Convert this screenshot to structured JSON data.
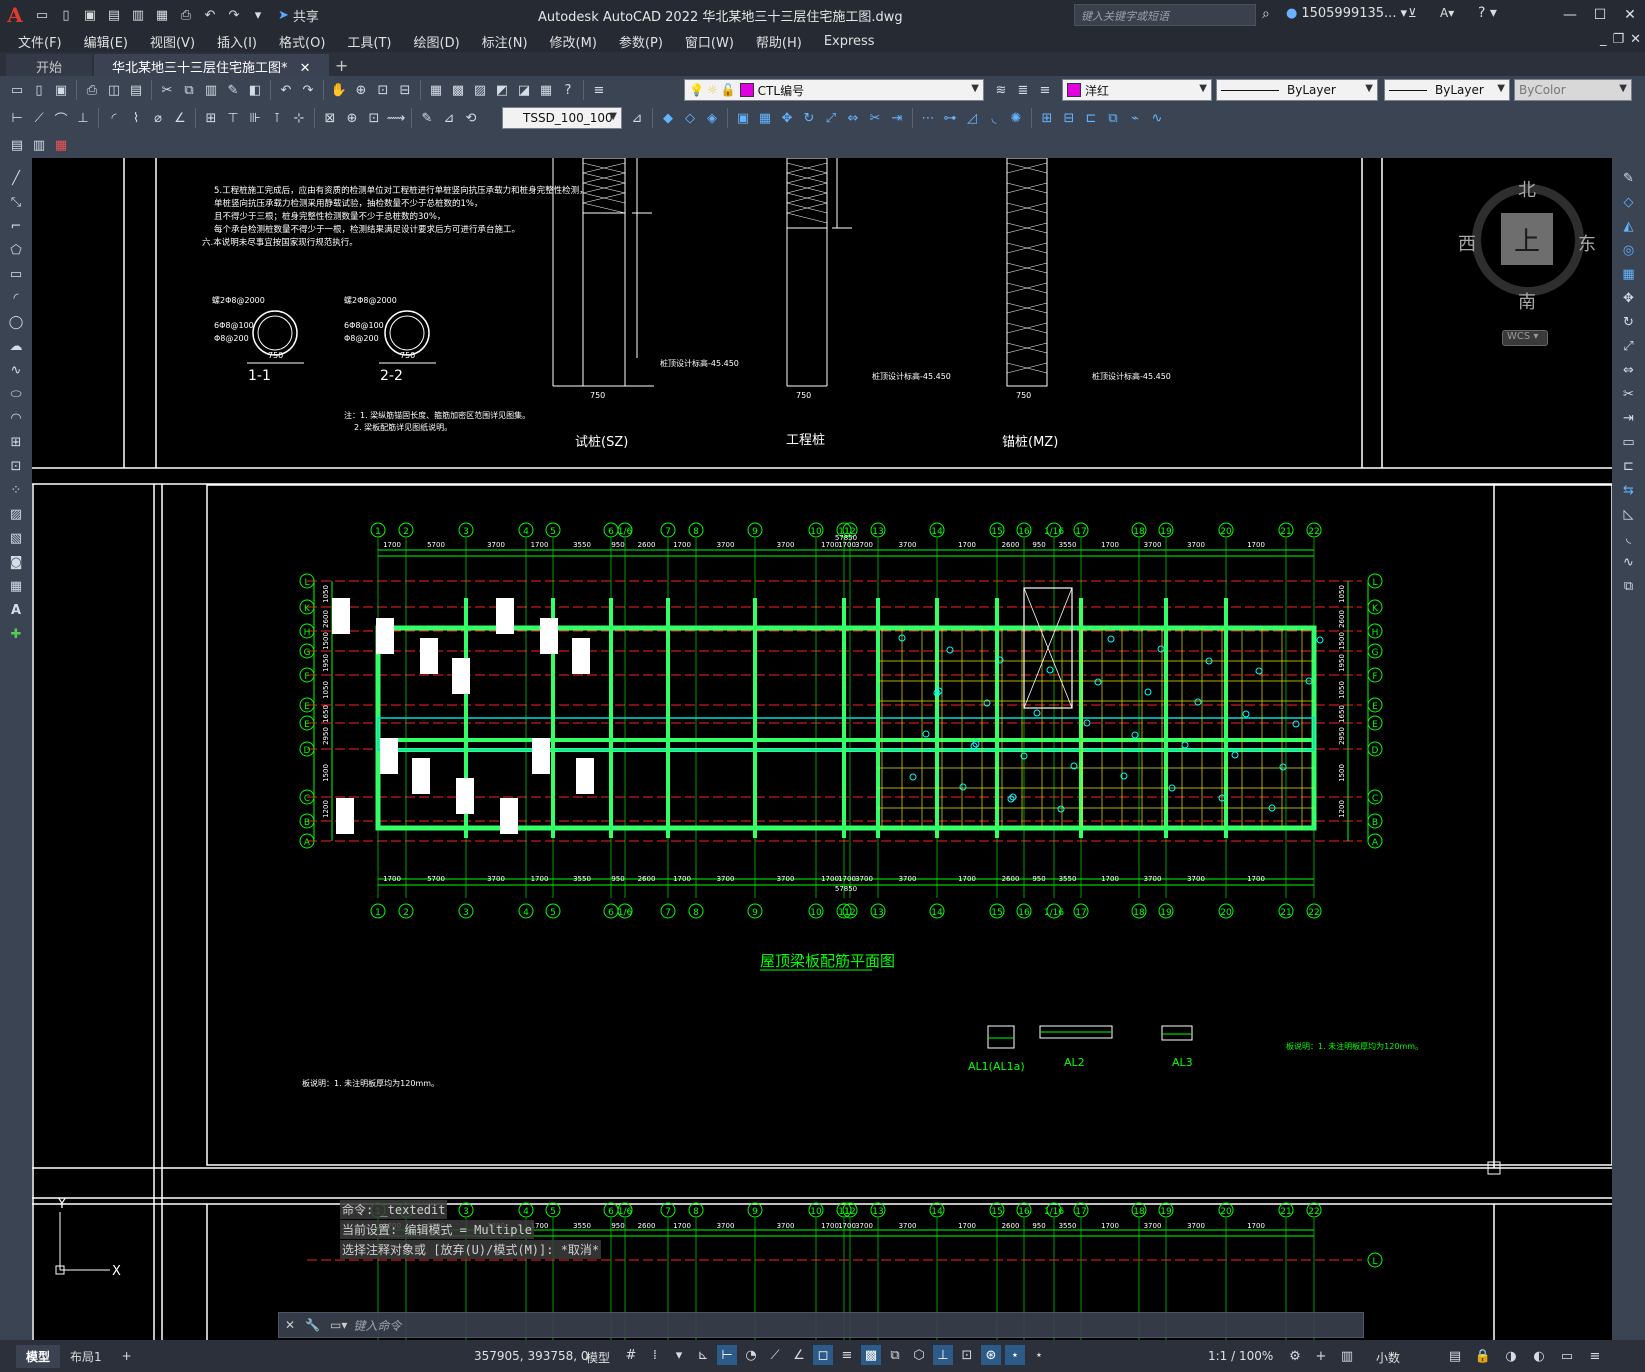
{
  "app": {
    "logo": "A",
    "title": "Autodesk AutoCAD 2022    华北某地三十三层住宅施工图.dwg",
    "search_placeholder": "键入关键字或短语",
    "user": "1505999135...",
    "share_label": "共享"
  },
  "menu": [
    "文件(F)",
    "编辑(E)",
    "视图(V)",
    "插入(I)",
    "格式(O)",
    "工具(T)",
    "绘图(D)",
    "标注(N)",
    "修改(M)",
    "参数(P)",
    "窗口(W)",
    "帮助(H)",
    "Express"
  ],
  "tabs": [
    {
      "label": "开始",
      "active": false
    },
    {
      "label": "华北某地三十三层住宅施工图*",
      "active": true
    }
  ],
  "toolbar": {
    "layer": "CTL编号",
    "color": "洋红",
    "color_hex": "#e000e0",
    "linetype": "ByLayer",
    "lineweight": "ByLayer",
    "plotstyle": "ByColor",
    "dimstyle": "TSSD_100_100"
  },
  "viewcube": {
    "north": "北",
    "south": "南",
    "east": "东",
    "west": "西",
    "face": "上",
    "wcs": "WCS"
  },
  "drawing": {
    "plan_title": "屋顶梁板配筋平面图",
    "top_labels": [
      "试桩(SZ)",
      "工程桩",
      "锚桩(MZ)"
    ],
    "section_labels": [
      "1-1",
      "2-2"
    ],
    "detail_labels": [
      "AL1(AL1a)",
      "AL2",
      "AL3"
    ],
    "dim_750": "750",
    "elev_1": "桩顶设计标高-45.450",
    "elev_2": "桩顶设计标高-45.450",
    "elev_3": "桩顶设计标高-45.450",
    "sec_rebar_1": "6Φ8@100",
    "sec_rebar_2": "Φ8@200",
    "sec_spiral": "螺2Φ8@2000",
    "note_left": "注：1. 梁纵筋锚固长度、箍筋加密区范围详见图集。",
    "note_left2": "2. 梁板配筋详见图纸说明。",
    "note_plan": "板说明：1. 未注明板厚均为120mm。",
    "top_notes": [
      "5.工程桩施工完成后，应由有资质的检测单位对工程桩进行单桩竖向抗压承载力和桩身完整性检测，",
      "单桩竖向抗压承载力检测采用静载试验，抽检数量不少于总桩数的1%，",
      "且不得少于三根；桩身完整性检测数量不少于总桩数的30%，",
      "每个承台检测桩数量不得少于一根，检测结果满足设计要求后方可进行承台施工。",
      "六.本说明未尽事宜按国家现行规范执行。"
    ],
    "axis_numbers": [
      "1",
      "2",
      "3",
      "4",
      "5",
      "6",
      "1/6",
      "7",
      "8",
      "9",
      "10",
      "11",
      "12",
      "13",
      "14",
      "15",
      "16",
      "1/16",
      "17",
      "18",
      "19",
      "20",
      "21",
      "22"
    ],
    "axis_letters": [
      "L",
      "K",
      "H",
      "G",
      "F",
      "E",
      "D",
      "C",
      "B",
      "A"
    ],
    "dims_top": [
      "1700",
      "5700",
      "3700",
      "1700",
      "3550",
      "950",
      "2600",
      "1700",
      "3700",
      "3700",
      "1700",
      "1700",
      "3700",
      "3700",
      "1700",
      "2600",
      "950",
      "3550",
      "1700",
      "3700",
      "3700",
      "1700"
    ],
    "total_dim": "57850",
    "side_dims": [
      "1050",
      "2600",
      "1500",
      "1950",
      "1050",
      "1650",
      "2950",
      "1500",
      "1200"
    ]
  },
  "command": {
    "history": [
      "命令: _textedit",
      "当前设置: 编辑模式 = Multiple",
      "选择注释对象或 [放弃(U)/模式(M)]: *取消*"
    ],
    "placeholder": "键入命令"
  },
  "status": {
    "layouts": [
      "模型",
      "布局1"
    ],
    "coords": "357905, 393758, 0",
    "space": "模型",
    "scale": "1:1 / 100%",
    "units": "小数"
  },
  "ucs": {
    "x": "X",
    "y": "Y"
  }
}
